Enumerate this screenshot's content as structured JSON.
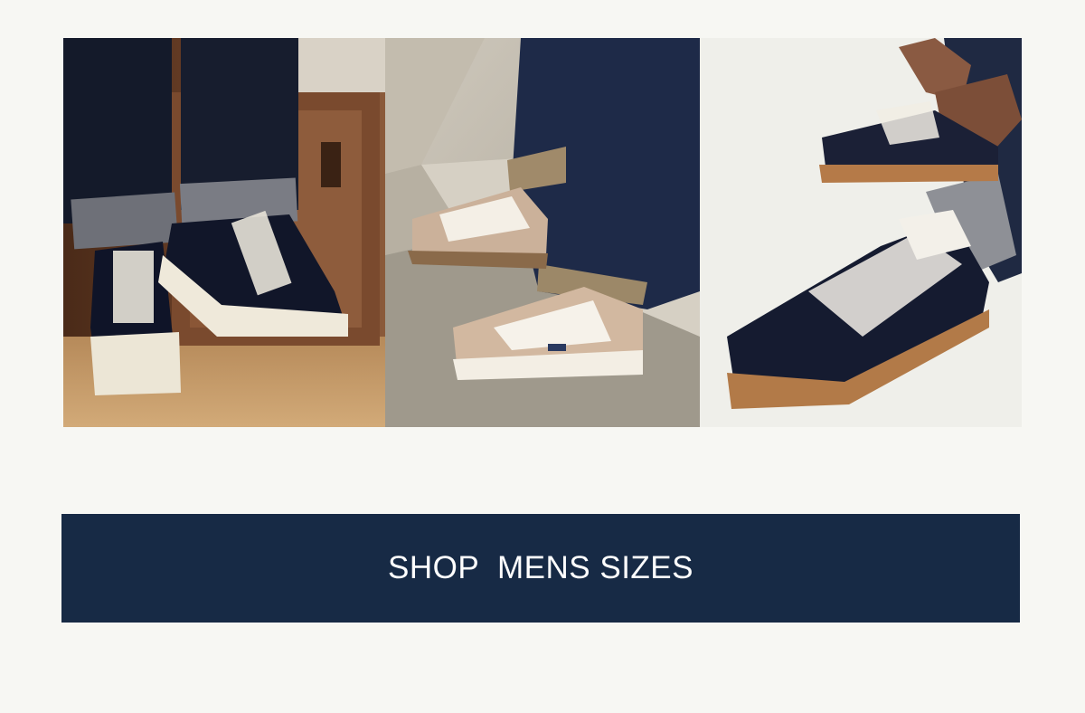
{
  "gallery": {
    "images": [
      {
        "subject": "high-top navy canvas sneakers with cream rubber soles, legs in raw denim, seated on wooden cabinet"
      },
      {
        "subject": "beige suede and white mesh low-top sneakers, dark denim jeans, on concrete steps"
      },
      {
        "subject": "navy leather and suede low-top sneakers with gum soles, hands tying laces"
      }
    ]
  },
  "cta": {
    "label": "SHOP  MENS SIZES"
  },
  "colors": {
    "page_background": "#f7f7f3",
    "button_background": "#172a45",
    "button_text": "#ffffff"
  }
}
